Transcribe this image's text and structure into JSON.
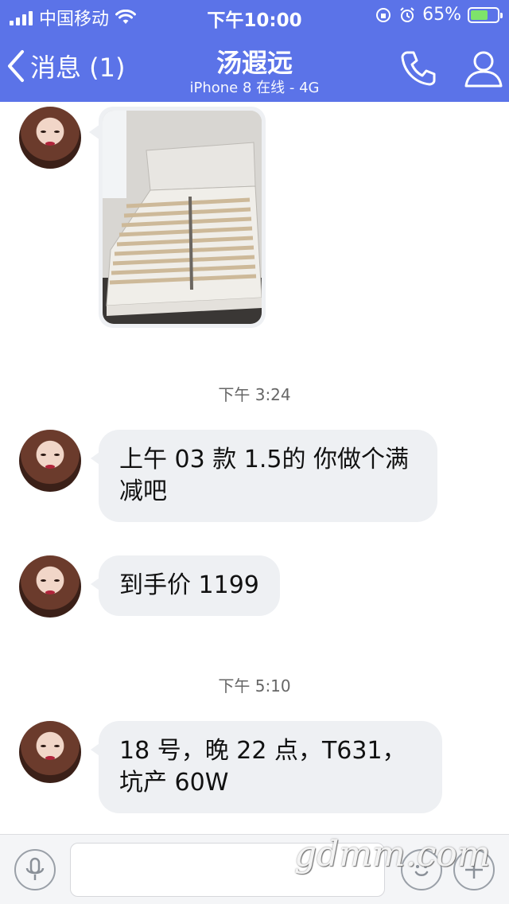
{
  "status_bar": {
    "carrier": "中国移动",
    "time": "下午10:00",
    "battery_percent": "65%",
    "battery_level": 0.65
  },
  "nav": {
    "back_label": "消息 (1)",
    "title": "汤遐远",
    "subtitle": "iPhone 8 在线 - 4G",
    "icons": [
      "chevron-left-icon",
      "phone-icon",
      "profile-icon"
    ]
  },
  "messages": [
    {
      "type": "image",
      "description_icon": "bed-photo"
    },
    {
      "type": "timestamp",
      "text": "下午 3:24"
    },
    {
      "type": "text",
      "text": "上午 03 款 1.5的  你做个满减吧"
    },
    {
      "type": "text",
      "text": "到手价 1199"
    },
    {
      "type": "timestamp",
      "text": "下午 5:10"
    },
    {
      "type": "text",
      "text": "18 号，晚 22 点，T631，坑产 60W"
    }
  ],
  "input_bar": {
    "placeholder": "",
    "icons": [
      "microphone-icon",
      "emoji-icon",
      "plus-icon"
    ]
  },
  "watermark": "gdmm.com",
  "colors": {
    "header_bg": "#5b73e8",
    "bubble_bg": "#eef0f3",
    "battery_fill": "#7ee36a"
  }
}
